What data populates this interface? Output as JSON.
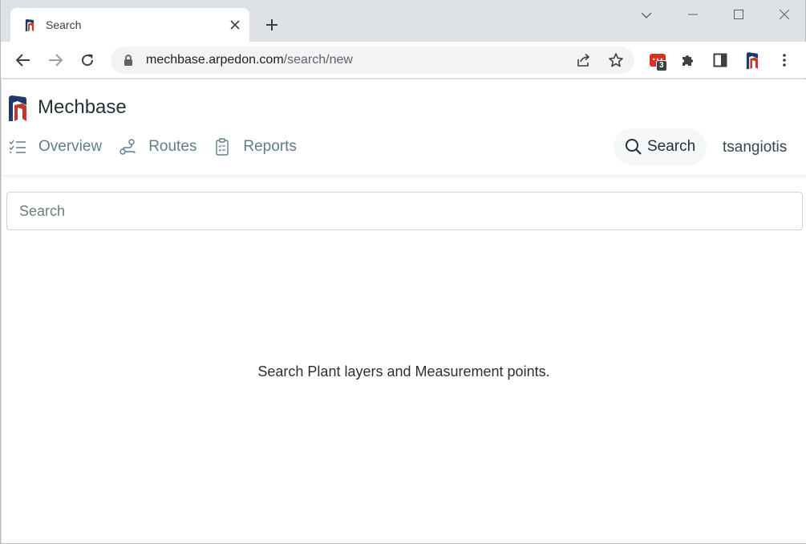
{
  "browser": {
    "tab": {
      "title": "Search",
      "favicon": "mechbase-logo-icon"
    },
    "url": {
      "host": "mechbase.arpedon.com",
      "path": "/search/new"
    },
    "extension_badge": "3",
    "colors": {
      "tab_strip": "#dee1e6",
      "omnibox": "#f1f3f4",
      "badge_red": "#d93025"
    }
  },
  "app": {
    "brand": "Mechbase",
    "nav": [
      {
        "label": "Overview",
        "icon": "checklist-icon"
      },
      {
        "label": "Routes",
        "icon": "route-icon"
      },
      {
        "label": "Reports",
        "icon": "clipboard-icon"
      }
    ],
    "search_button": "Search",
    "user": "tsangiotis",
    "colors": {
      "brand_blue": "#1f3a68",
      "brand_red": "#c0392b",
      "nav_text": "#607d8b"
    }
  },
  "search": {
    "placeholder": "Search",
    "value": ""
  },
  "empty_state": "Search Plant layers and Measurement points."
}
